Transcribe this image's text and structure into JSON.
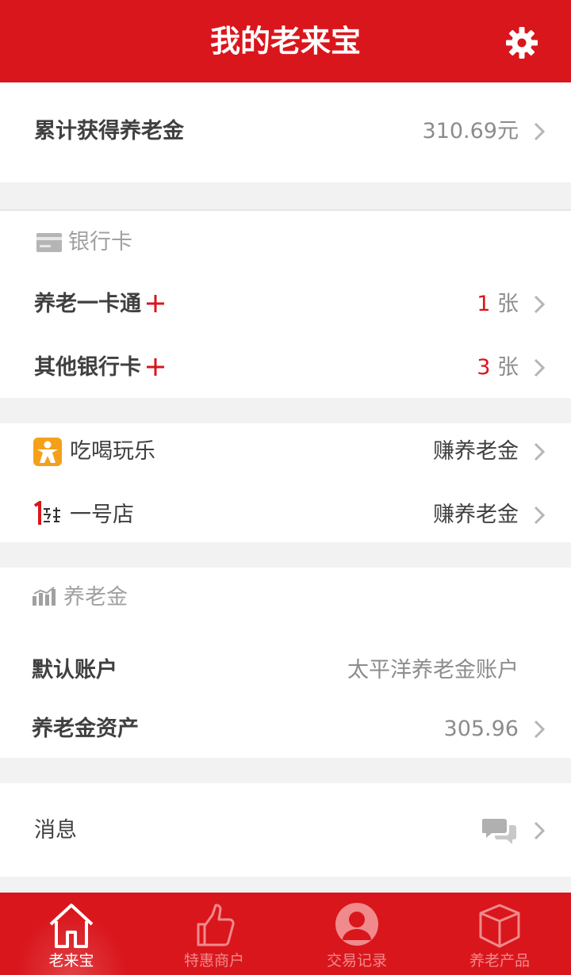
{
  "header": {
    "title": "我的老来宝",
    "settings_icon": "gear-icon"
  },
  "summary": {
    "label": "累计获得养老金",
    "value": "310.69元"
  },
  "bank_cards": {
    "title": "银行卡",
    "items": [
      {
        "label": "养老一卡通",
        "count": "1",
        "unit": "张"
      },
      {
        "label": "其他银行卡",
        "count": "3",
        "unit": "张"
      }
    ]
  },
  "earn": {
    "items": [
      {
        "label": "吃喝玩乐",
        "value": "赚养老金"
      },
      {
        "label": "一号店",
        "value": "赚养老金"
      }
    ]
  },
  "pension": {
    "title": "养老金",
    "items": [
      {
        "label": "默认账户",
        "value": "太平洋养老金账户"
      },
      {
        "label": "养老金资产",
        "value": "305.96"
      }
    ]
  },
  "messages": {
    "label": "消息"
  },
  "tabbar": {
    "tabs": [
      {
        "label": "老来宝",
        "active": true
      },
      {
        "label": "特惠商户",
        "active": false
      },
      {
        "label": "交易记录",
        "active": false
      },
      {
        "label": "养老产品",
        "active": false
      }
    ]
  },
  "colors": {
    "brand_red": "#d9161c",
    "orange": "#f28a00",
    "text_gray": "#404040",
    "muted_gray": "#8c8c8c"
  }
}
